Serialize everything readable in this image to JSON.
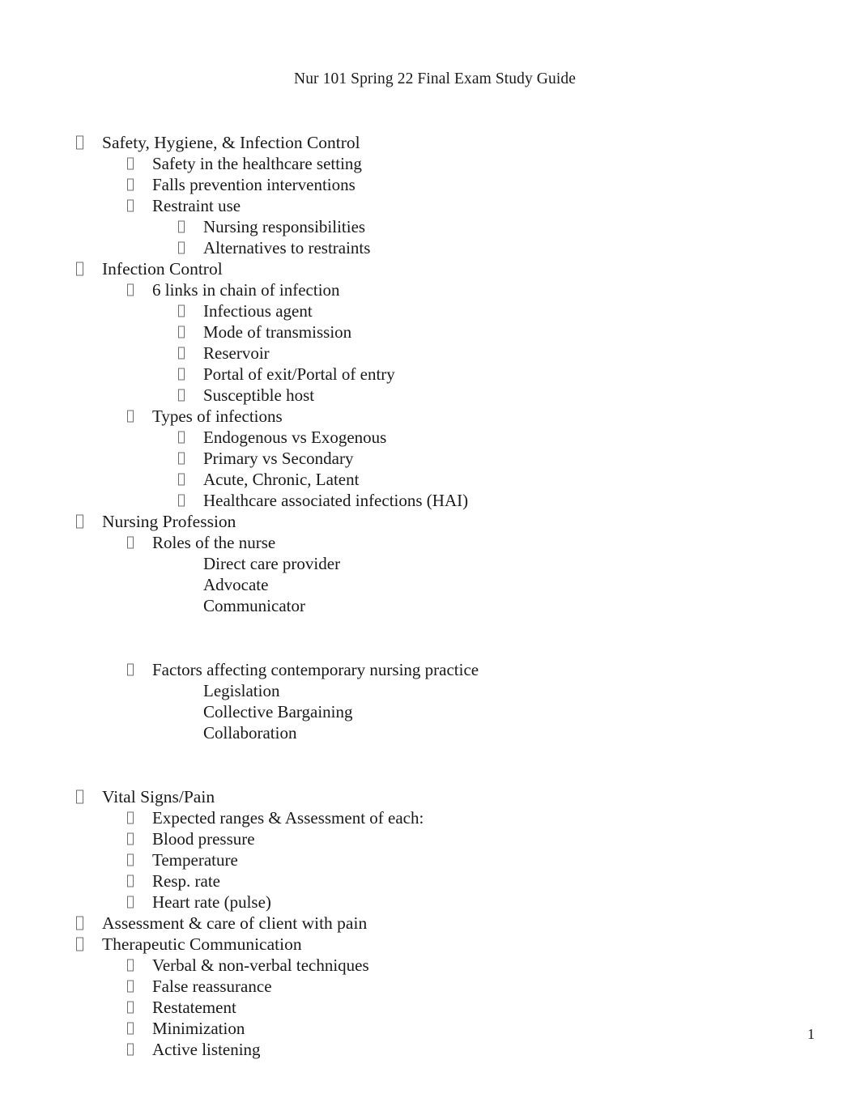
{
  "document": {
    "header": "Nur 101 Spring 22 Final Exam Study Guide",
    "page_number": "1",
    "bullet_glyph": "missing-glyph-box"
  },
  "outline": [
    {
      "level": 1,
      "text": "Safety, Hygiene, & Infection Control"
    },
    {
      "level": 2,
      "text": "Safety in the healthcare setting"
    },
    {
      "level": 2,
      "text": "Falls prevention interventions"
    },
    {
      "level": 2,
      "text": "Restraint use"
    },
    {
      "level": 3,
      "text": "Nursing responsibilities"
    },
    {
      "level": 3,
      "text": "Alternatives to restraints"
    },
    {
      "level": 1,
      "text": "Infection Control"
    },
    {
      "level": 2,
      "text": "6 links in chain of infection"
    },
    {
      "level": 3,
      "text": "Infectious agent"
    },
    {
      "level": 3,
      "text": "Mode of transmission"
    },
    {
      "level": 3,
      "text": "Reservoir"
    },
    {
      "level": 3,
      "text": "Portal of exit/Portal of entry"
    },
    {
      "level": 3,
      "text": "Susceptible host"
    },
    {
      "level": 2,
      "text": "Types of infections"
    },
    {
      "level": 3,
      "text": "Endogenous vs Exogenous"
    },
    {
      "level": 3,
      "text": "Primary vs Secondary"
    },
    {
      "level": 3,
      "text": "Acute, Chronic, Latent"
    },
    {
      "level": 3,
      "text": "Healthcare associated infections (HAI)"
    },
    {
      "level": 1,
      "text": "Nursing Profession"
    },
    {
      "level": 2,
      "text": "Roles of the nurse"
    },
    {
      "level": 0,
      "text": "Direct care provider"
    },
    {
      "level": 0,
      "text": "Advocate"
    },
    {
      "level": 0,
      "text": "Communicator"
    },
    {
      "level": -1,
      "text": ""
    },
    {
      "level": 2,
      "text": "Factors affecting contemporary nursing practice"
    },
    {
      "level": 0,
      "text": "Legislation"
    },
    {
      "level": 0,
      "text": "Collective Bargaining"
    },
    {
      "level": 0,
      "text": "Collaboration"
    },
    {
      "level": -1,
      "text": ""
    },
    {
      "level": 1,
      "text": "Vital Signs/Pain"
    },
    {
      "level": 2,
      "text": "Expected ranges & Assessment of each:"
    },
    {
      "level": 2,
      "text": "Blood pressure"
    },
    {
      "level": 2,
      "text": "Temperature"
    },
    {
      "level": 2,
      "text": "Resp. rate"
    },
    {
      "level": 2,
      "text": "Heart rate (pulse)"
    },
    {
      "level": 1,
      "text": "Assessment & care of client with pain"
    },
    {
      "level": 1,
      "text": "Therapeutic Communication"
    },
    {
      "level": 2,
      "text": "Verbal & non-verbal techniques"
    },
    {
      "level": 2,
      "text": "False reassurance"
    },
    {
      "level": 2,
      "text": "Restatement"
    },
    {
      "level": 2,
      "text": "Minimization"
    },
    {
      "level": 2,
      "text": "Active listening"
    }
  ]
}
